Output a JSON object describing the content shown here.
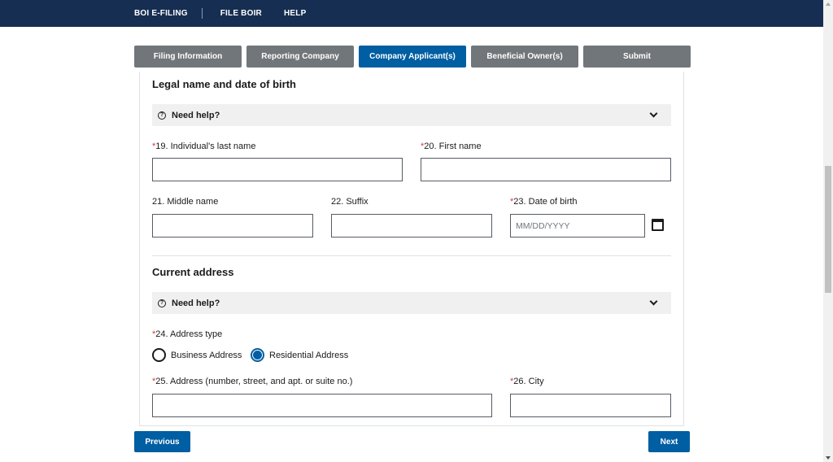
{
  "topnav": {
    "brand": "BOI E-FILING",
    "file_boir": "FILE BOIR",
    "help": "HELP"
  },
  "steps": [
    {
      "label": "Filing Information"
    },
    {
      "label": "Reporting Company"
    },
    {
      "label": "Company Applicant(s)"
    },
    {
      "label": "Beneficial Owner(s)"
    },
    {
      "label": "Submit"
    }
  ],
  "active_step": "Company Applicant(s)",
  "section1": {
    "title": "Legal name and date of birth",
    "help": "Need help?",
    "fields": {
      "last_name": {
        "req": "*",
        "label": "19. Individual's last name",
        "value": ""
      },
      "first_name": {
        "req": "*",
        "label": "20. First name",
        "value": ""
      },
      "middle_name": {
        "label": "21. Middle name",
        "value": ""
      },
      "suffix": {
        "label": "22. Suffix",
        "value": ""
      },
      "dob": {
        "req": "*",
        "label": "23. Date of birth",
        "placeholder": "MM/DD/YYYY"
      }
    }
  },
  "section2": {
    "title": "Current address",
    "help": "Need help?",
    "address_type": {
      "req": "*",
      "label": "24. Address type",
      "options": [
        "Business Address",
        "Residential Address"
      ],
      "selected": "Residential Address"
    },
    "fields": {
      "address": {
        "req": "*",
        "label": "25. Address (number, street, and apt. or suite no.)",
        "value": ""
      },
      "city": {
        "req": "*",
        "label": "26. City",
        "value": ""
      }
    }
  },
  "buttons": {
    "previous": "Previous",
    "next": "Next"
  },
  "colors": {
    "primary": "#005ea2",
    "header": "#162e51",
    "inactive_step": "#71767a",
    "required": "#d83933"
  },
  "icons": [
    "help-circle-icon",
    "chevron-down-icon",
    "calendar-icon"
  ]
}
